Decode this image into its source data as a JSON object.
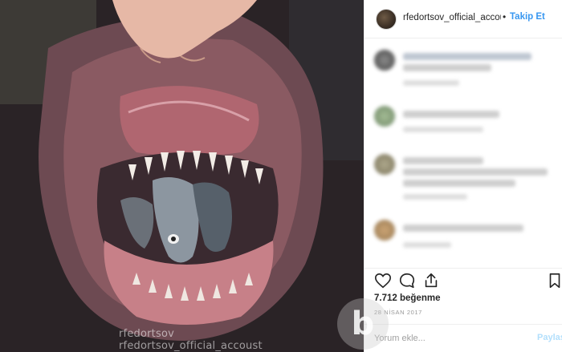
{
  "post": {
    "photo_watermarks": [
      "rfedortsov",
      "rfedortsov_official_accoust"
    ],
    "header": {
      "username": "rfedortsov_official_accou",
      "separator": "•",
      "follow_label": "Takip Et"
    },
    "comments": [
      {
        "id": 1,
        "blurred": true
      },
      {
        "id": 2,
        "blurred": true
      },
      {
        "id": 3,
        "blurred": true
      },
      {
        "id": 4,
        "blurred": true
      }
    ],
    "actions": {
      "icons": [
        "heart-icon",
        "comment-icon",
        "share-icon",
        "bookmark-icon"
      ]
    },
    "likes_text": "7.712 beğenme",
    "date_text": "28 NİSAN 2017",
    "add_comment_placeholder": "Yorum ekle...",
    "post_button_label": "Paylaş"
  },
  "colors": {
    "link_blue": "#3897f0",
    "post_disabled": "#b2dffc",
    "text": "#262626",
    "muted": "#999999"
  }
}
